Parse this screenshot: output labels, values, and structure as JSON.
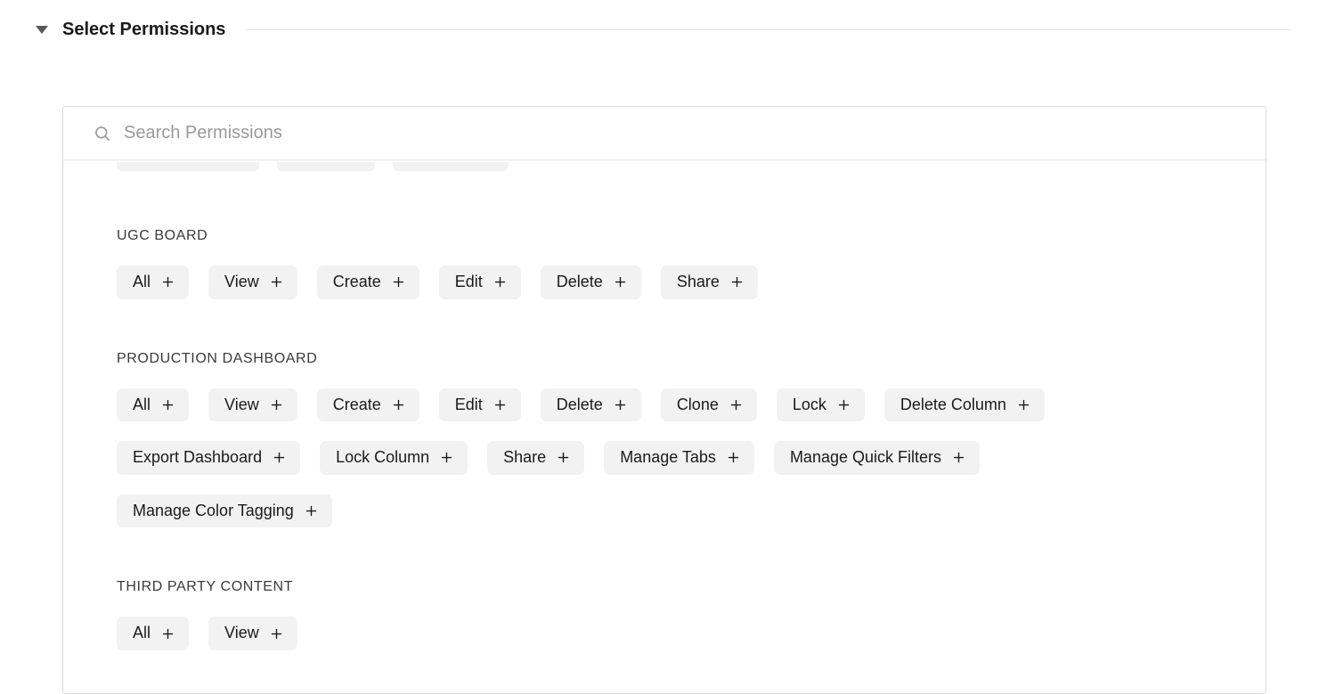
{
  "header": {
    "title": "Select Permissions"
  },
  "search": {
    "placeholder": "Search Permissions",
    "value": ""
  },
  "groups": [
    {
      "title": "UGC BOARD",
      "permissions": [
        "All",
        "View",
        "Create",
        "Edit",
        "Delete",
        "Share"
      ]
    },
    {
      "title": "PRODUCTION DASHBOARD",
      "permissions": [
        "All",
        "View",
        "Create",
        "Edit",
        "Delete",
        "Clone",
        "Lock",
        "Delete Column",
        "Export Dashboard",
        "Lock Column",
        "Share",
        "Manage Tabs",
        "Manage Quick Filters",
        "Manage Color Tagging"
      ]
    },
    {
      "title": "THIRD PARTY CONTENT",
      "permissions": [
        "All",
        "View"
      ]
    }
  ]
}
